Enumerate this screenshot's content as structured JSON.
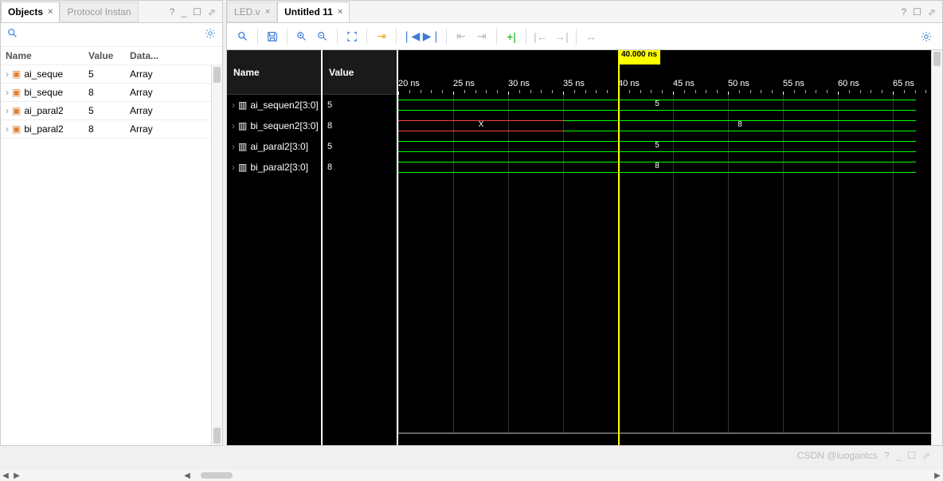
{
  "left_panel": {
    "tabs": [
      {
        "label": "Objects",
        "active": true
      },
      {
        "label": "Protocol Instan",
        "active": false
      }
    ],
    "search_placeholder": "",
    "headers": {
      "name": "Name",
      "value": "Value",
      "data": "Data..."
    },
    "rows": [
      {
        "name": "ai_seque",
        "value": "5",
        "data": "Array"
      },
      {
        "name": "bi_seque",
        "value": "8",
        "data": "Array"
      },
      {
        "name": "ai_paral2",
        "value": "5",
        "data": "Array"
      },
      {
        "name": "bi_paral2",
        "value": "8",
        "data": "Array"
      }
    ]
  },
  "right_panel": {
    "tabs": [
      {
        "label": "LED.v",
        "active": false
      },
      {
        "label": "Untitled 11",
        "active": true
      }
    ],
    "name_header": "Name",
    "value_header": "Value",
    "signals": [
      {
        "name": "ai_sequen2[3:0]",
        "value": "5"
      },
      {
        "name": "bi_sequen2[3:0]",
        "value": "8"
      },
      {
        "name": "ai_paral2[3:0]",
        "value": "5"
      },
      {
        "name": "bi_paral2[3:0]",
        "value": "8"
      }
    ],
    "cursor_time": "40.000 ns",
    "ticks": [
      "20 ns",
      "25 ns",
      "30 ns",
      "35 ns",
      "40 ns",
      "45 ns",
      "50 ns",
      "55 ns",
      "60 ns",
      "65 ns"
    ],
    "waves": [
      {
        "segments": [
          {
            "from": 0,
            "to": 650,
            "val": "5",
            "color": "g"
          }
        ]
      },
      {
        "segments": [
          {
            "from": 0,
            "to": 208,
            "val": "X",
            "color": "r"
          },
          {
            "from": 208,
            "to": 650,
            "val": "8",
            "color": "g"
          }
        ]
      },
      {
        "segments": [
          {
            "from": 0,
            "to": 650,
            "val": "5",
            "color": "g"
          }
        ]
      },
      {
        "segments": [
          {
            "from": 0,
            "to": 650,
            "val": "8",
            "color": "g"
          }
        ]
      }
    ]
  },
  "footer_text": "CSDN @luogantcs"
}
